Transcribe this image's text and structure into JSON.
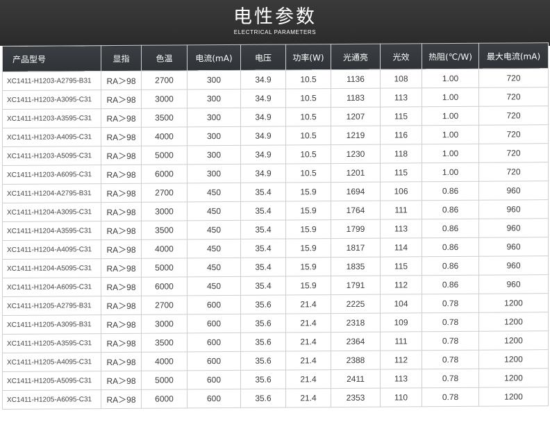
{
  "header": {
    "title": "电性参数",
    "subtitle": "ELECTRICAL PARAMETERS"
  },
  "table": {
    "columns": [
      "产品型号",
      "显指",
      "色温",
      "电流(mA)",
      "电压",
      "功率(W)",
      "光通亮",
      "光效",
      "热阻(℃/W)",
      "最大电流(mA)"
    ],
    "rows": [
      [
        "XC1411-H1203-A2795-B31",
        "RA＞98",
        "2700",
        "300",
        "34.9",
        "10.5",
        "1136",
        "108",
        "1.00",
        "720"
      ],
      [
        "XC1411-H1203-A3095-C31",
        "RA＞98",
        "3000",
        "300",
        "34.9",
        "10.5",
        "1183",
        "113",
        "1.00",
        "720"
      ],
      [
        "XC1411-H1203-A3595-C31",
        "RA＞98",
        "3500",
        "300",
        "34.9",
        "10.5",
        "1207",
        "115",
        "1.00",
        "720"
      ],
      [
        "XC1411-H1203-A4095-C31",
        "RA＞98",
        "4000",
        "300",
        "34.9",
        "10.5",
        "1219",
        "116",
        "1.00",
        "720"
      ],
      [
        "XC1411-H1203-A5095-C31",
        "RA＞98",
        "5000",
        "300",
        "34.9",
        "10.5",
        "1230",
        "118",
        "1.00",
        "720"
      ],
      [
        "XC1411-H1203-A6095-C31",
        "RA＞98",
        "6000",
        "300",
        "34.9",
        "10.5",
        "1201",
        "115",
        "1.00",
        "720"
      ],
      [
        "XC1411-H1204-A2795-B31",
        "RA＞98",
        "2700",
        "450",
        "35.4",
        "15.9",
        "1694",
        "106",
        "0.86",
        "960"
      ],
      [
        "XC1411-H1204-A3095-C31",
        "RA＞98",
        "3000",
        "450",
        "35.4",
        "15.9",
        "1764",
        "111",
        "0.86",
        "960"
      ],
      [
        "XC1411-H1204-A3595-C31",
        "RA＞98",
        "3500",
        "450",
        "35.4",
        "15.9",
        "1799",
        "113",
        "0.86",
        "960"
      ],
      [
        "XC1411-H1204-A4095-C31",
        "RA＞98",
        "4000",
        "450",
        "35.4",
        "15.9",
        "1817",
        "114",
        "0.86",
        "960"
      ],
      [
        "XC1411-H1204-A5095-C31",
        "RA＞98",
        "5000",
        "450",
        "35.4",
        "15.9",
        "1835",
        "115",
        "0.86",
        "960"
      ],
      [
        "XC1411-H1204-A6095-C31",
        "RA＞98",
        "6000",
        "450",
        "35.4",
        "15.9",
        "1791",
        "112",
        "0.86",
        "960"
      ],
      [
        "XC1411-H1205-A2795-B31",
        "RA＞98",
        "2700",
        "600",
        "35.6",
        "21.4",
        "2225",
        "104",
        "0.78",
        "1200"
      ],
      [
        "XC1411-H1205-A3095-B31",
        "RA＞98",
        "3000",
        "600",
        "35.6",
        "21.4",
        "2318",
        "109",
        "0.78",
        "1200"
      ],
      [
        "XC1411-H1205-A3595-C31",
        "RA＞98",
        "3500",
        "600",
        "35.6",
        "21.4",
        "2364",
        "111",
        "0.78",
        "1200"
      ],
      [
        "XC1411-H1205-A4095-C31",
        "RA＞98",
        "4000",
        "600",
        "35.6",
        "21.4",
        "2388",
        "112",
        "0.78",
        "1200"
      ],
      [
        "XC1411-H1205-A5095-C31",
        "RA＞98",
        "5000",
        "600",
        "35.6",
        "21.4",
        "2411",
        "113",
        "0.78",
        "1200"
      ],
      [
        "XC1411-H1205-A6095-C31",
        "RA＞98",
        "6000",
        "600",
        "35.6",
        "21.4",
        "2353",
        "110",
        "0.78",
        "1200"
      ]
    ]
  },
  "colors": {
    "header_bg": "#2f3337",
    "banner_bg": "#333333",
    "text": "#3a3a3a",
    "border": "#cfcfcf"
  }
}
